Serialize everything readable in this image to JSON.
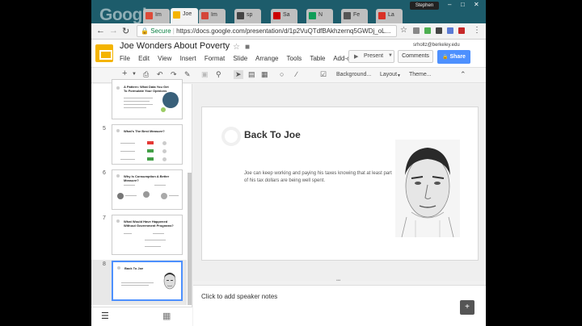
{
  "browser": {
    "profile": "Stephen",
    "brand_text": "Google",
    "tabs": [
      {
        "label": "Im",
        "color": "#dd4b39",
        "active": false
      },
      {
        "label": "Joe",
        "color": "#f4b400",
        "active": true
      },
      {
        "label": "Im",
        "color": "#d44638",
        "active": false
      },
      {
        "label": "sp",
        "color": "#444444",
        "active": false
      },
      {
        "label": "Sa",
        "color": "#cc0000",
        "active": false
      },
      {
        "label": "N",
        "color": "#0f9d58",
        "active": false
      },
      {
        "label": "Fe",
        "color": "#555555",
        "active": false
      },
      {
        "label": "La",
        "color": "#d93025",
        "active": false
      }
    ],
    "secure_label": "Secure",
    "url": "https://docs.google.com/presentation/d/1p2VuQTdfBAkhzernq5GWDj_oL..."
  },
  "doc": {
    "title": "Joe Wonders About Poverty",
    "user_email": "srholtz@berkeley.edu",
    "menus": [
      "File",
      "Edit",
      "View",
      "Insert",
      "Format",
      "Slide",
      "Arrange",
      "Tools",
      "Table",
      "Add-ons"
    ],
    "present_label": "Present",
    "comments_label": "Comments",
    "share_label": "Share"
  },
  "toolbar": {
    "background_label": "Background...",
    "layout_label": "Layout",
    "theme_label": "Theme..."
  },
  "filmstrip": {
    "slides": [
      {
        "number": "",
        "title": "A Pattern: What Data You Get To Formulate Your Opinions"
      },
      {
        "number": "5",
        "title": "What's The Best Measure?"
      },
      {
        "number": "6",
        "title": "Why Is Consumption A Better Measure?"
      },
      {
        "number": "7",
        "title": "What Would Have Happened Without Government Programs?"
      },
      {
        "number": "8",
        "title": "Back To Joe"
      }
    ]
  },
  "slide": {
    "title": "Back To Joe",
    "body": "Joe can keep working and paying his taxes knowing that at least part of his tax dollars are being well spent."
  },
  "notes": {
    "placeholder": "Click to add speaker notes"
  },
  "colors": {
    "accent": "#4d90fe",
    "docs_yellow": "#f4b400",
    "tabstrip": "#1d5c6b"
  }
}
